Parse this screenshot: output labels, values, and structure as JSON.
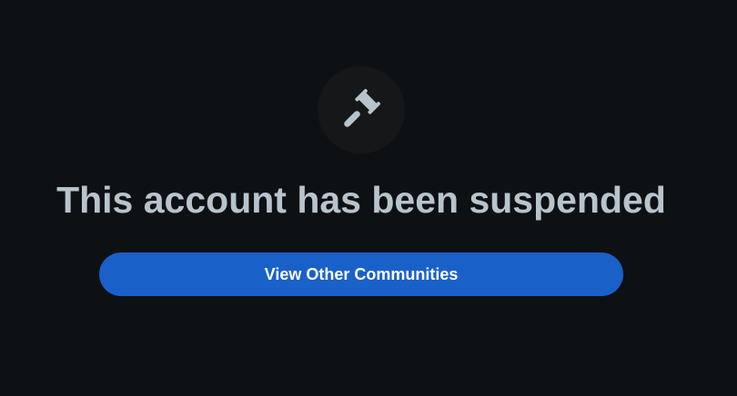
{
  "suspension": {
    "icon": "gavel-icon",
    "title": "This account has been suspended",
    "action_label": "View Other Communities"
  },
  "colors": {
    "background": "#0e1114",
    "icon_circle": "#161718",
    "icon": "#b7c4cc",
    "title_text": "#b7c4cc",
    "button": "#1a60c9",
    "button_text": "#ffffff"
  }
}
